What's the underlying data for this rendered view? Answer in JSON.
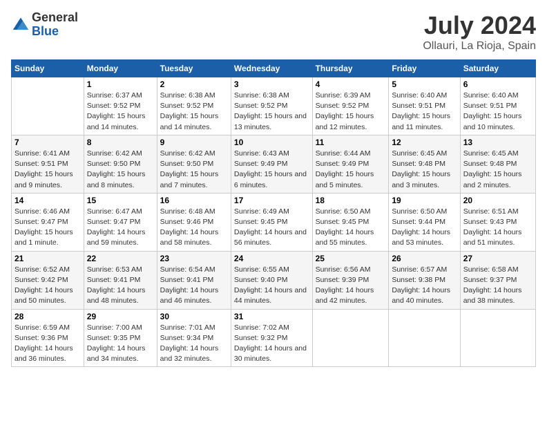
{
  "header": {
    "logo_general": "General",
    "logo_blue": "Blue",
    "title": "July 2024",
    "subtitle": "Ollauri, La Rioja, Spain"
  },
  "columns": [
    "Sunday",
    "Monday",
    "Tuesday",
    "Wednesday",
    "Thursday",
    "Friday",
    "Saturday"
  ],
  "weeks": [
    [
      {
        "day": "",
        "sunrise": "",
        "sunset": "",
        "daylight": "",
        "empty": true
      },
      {
        "day": "1",
        "sunrise": "Sunrise: 6:37 AM",
        "sunset": "Sunset: 9:52 PM",
        "daylight": "Daylight: 15 hours and 14 minutes."
      },
      {
        "day": "2",
        "sunrise": "Sunrise: 6:38 AM",
        "sunset": "Sunset: 9:52 PM",
        "daylight": "Daylight: 15 hours and 14 minutes."
      },
      {
        "day": "3",
        "sunrise": "Sunrise: 6:38 AM",
        "sunset": "Sunset: 9:52 PM",
        "daylight": "Daylight: 15 hours and 13 minutes."
      },
      {
        "day": "4",
        "sunrise": "Sunrise: 6:39 AM",
        "sunset": "Sunset: 9:52 PM",
        "daylight": "Daylight: 15 hours and 12 minutes."
      },
      {
        "day": "5",
        "sunrise": "Sunrise: 6:40 AM",
        "sunset": "Sunset: 9:51 PM",
        "daylight": "Daylight: 15 hours and 11 minutes."
      },
      {
        "day": "6",
        "sunrise": "Sunrise: 6:40 AM",
        "sunset": "Sunset: 9:51 PM",
        "daylight": "Daylight: 15 hours and 10 minutes."
      }
    ],
    [
      {
        "day": "7",
        "sunrise": "Sunrise: 6:41 AM",
        "sunset": "Sunset: 9:51 PM",
        "daylight": "Daylight: 15 hours and 9 minutes."
      },
      {
        "day": "8",
        "sunrise": "Sunrise: 6:42 AM",
        "sunset": "Sunset: 9:50 PM",
        "daylight": "Daylight: 15 hours and 8 minutes."
      },
      {
        "day": "9",
        "sunrise": "Sunrise: 6:42 AM",
        "sunset": "Sunset: 9:50 PM",
        "daylight": "Daylight: 15 hours and 7 minutes."
      },
      {
        "day": "10",
        "sunrise": "Sunrise: 6:43 AM",
        "sunset": "Sunset: 9:49 PM",
        "daylight": "Daylight: 15 hours and 6 minutes."
      },
      {
        "day": "11",
        "sunrise": "Sunrise: 6:44 AM",
        "sunset": "Sunset: 9:49 PM",
        "daylight": "Daylight: 15 hours and 5 minutes."
      },
      {
        "day": "12",
        "sunrise": "Sunrise: 6:45 AM",
        "sunset": "Sunset: 9:48 PM",
        "daylight": "Daylight: 15 hours and 3 minutes."
      },
      {
        "day": "13",
        "sunrise": "Sunrise: 6:45 AM",
        "sunset": "Sunset: 9:48 PM",
        "daylight": "Daylight: 15 hours and 2 minutes."
      }
    ],
    [
      {
        "day": "14",
        "sunrise": "Sunrise: 6:46 AM",
        "sunset": "Sunset: 9:47 PM",
        "daylight": "Daylight: 15 hours and 1 minute."
      },
      {
        "day": "15",
        "sunrise": "Sunrise: 6:47 AM",
        "sunset": "Sunset: 9:47 PM",
        "daylight": "Daylight: 14 hours and 59 minutes."
      },
      {
        "day": "16",
        "sunrise": "Sunrise: 6:48 AM",
        "sunset": "Sunset: 9:46 PM",
        "daylight": "Daylight: 14 hours and 58 minutes."
      },
      {
        "day": "17",
        "sunrise": "Sunrise: 6:49 AM",
        "sunset": "Sunset: 9:45 PM",
        "daylight": "Daylight: 14 hours and 56 minutes."
      },
      {
        "day": "18",
        "sunrise": "Sunrise: 6:50 AM",
        "sunset": "Sunset: 9:45 PM",
        "daylight": "Daylight: 14 hours and 55 minutes."
      },
      {
        "day": "19",
        "sunrise": "Sunrise: 6:50 AM",
        "sunset": "Sunset: 9:44 PM",
        "daylight": "Daylight: 14 hours and 53 minutes."
      },
      {
        "day": "20",
        "sunrise": "Sunrise: 6:51 AM",
        "sunset": "Sunset: 9:43 PM",
        "daylight": "Daylight: 14 hours and 51 minutes."
      }
    ],
    [
      {
        "day": "21",
        "sunrise": "Sunrise: 6:52 AM",
        "sunset": "Sunset: 9:42 PM",
        "daylight": "Daylight: 14 hours and 50 minutes."
      },
      {
        "day": "22",
        "sunrise": "Sunrise: 6:53 AM",
        "sunset": "Sunset: 9:41 PM",
        "daylight": "Daylight: 14 hours and 48 minutes."
      },
      {
        "day": "23",
        "sunrise": "Sunrise: 6:54 AM",
        "sunset": "Sunset: 9:41 PM",
        "daylight": "Daylight: 14 hours and 46 minutes."
      },
      {
        "day": "24",
        "sunrise": "Sunrise: 6:55 AM",
        "sunset": "Sunset: 9:40 PM",
        "daylight": "Daylight: 14 hours and 44 minutes."
      },
      {
        "day": "25",
        "sunrise": "Sunrise: 6:56 AM",
        "sunset": "Sunset: 9:39 PM",
        "daylight": "Daylight: 14 hours and 42 minutes."
      },
      {
        "day": "26",
        "sunrise": "Sunrise: 6:57 AM",
        "sunset": "Sunset: 9:38 PM",
        "daylight": "Daylight: 14 hours and 40 minutes."
      },
      {
        "day": "27",
        "sunrise": "Sunrise: 6:58 AM",
        "sunset": "Sunset: 9:37 PM",
        "daylight": "Daylight: 14 hours and 38 minutes."
      }
    ],
    [
      {
        "day": "28",
        "sunrise": "Sunrise: 6:59 AM",
        "sunset": "Sunset: 9:36 PM",
        "daylight": "Daylight: 14 hours and 36 minutes."
      },
      {
        "day": "29",
        "sunrise": "Sunrise: 7:00 AM",
        "sunset": "Sunset: 9:35 PM",
        "daylight": "Daylight: 14 hours and 34 minutes."
      },
      {
        "day": "30",
        "sunrise": "Sunrise: 7:01 AM",
        "sunset": "Sunset: 9:34 PM",
        "daylight": "Daylight: 14 hours and 32 minutes."
      },
      {
        "day": "31",
        "sunrise": "Sunrise: 7:02 AM",
        "sunset": "Sunset: 9:32 PM",
        "daylight": "Daylight: 14 hours and 30 minutes."
      },
      {
        "day": "",
        "sunrise": "",
        "sunset": "",
        "daylight": "",
        "empty": true
      },
      {
        "day": "",
        "sunrise": "",
        "sunset": "",
        "daylight": "",
        "empty": true
      },
      {
        "day": "",
        "sunrise": "",
        "sunset": "",
        "daylight": "",
        "empty": true
      }
    ]
  ]
}
